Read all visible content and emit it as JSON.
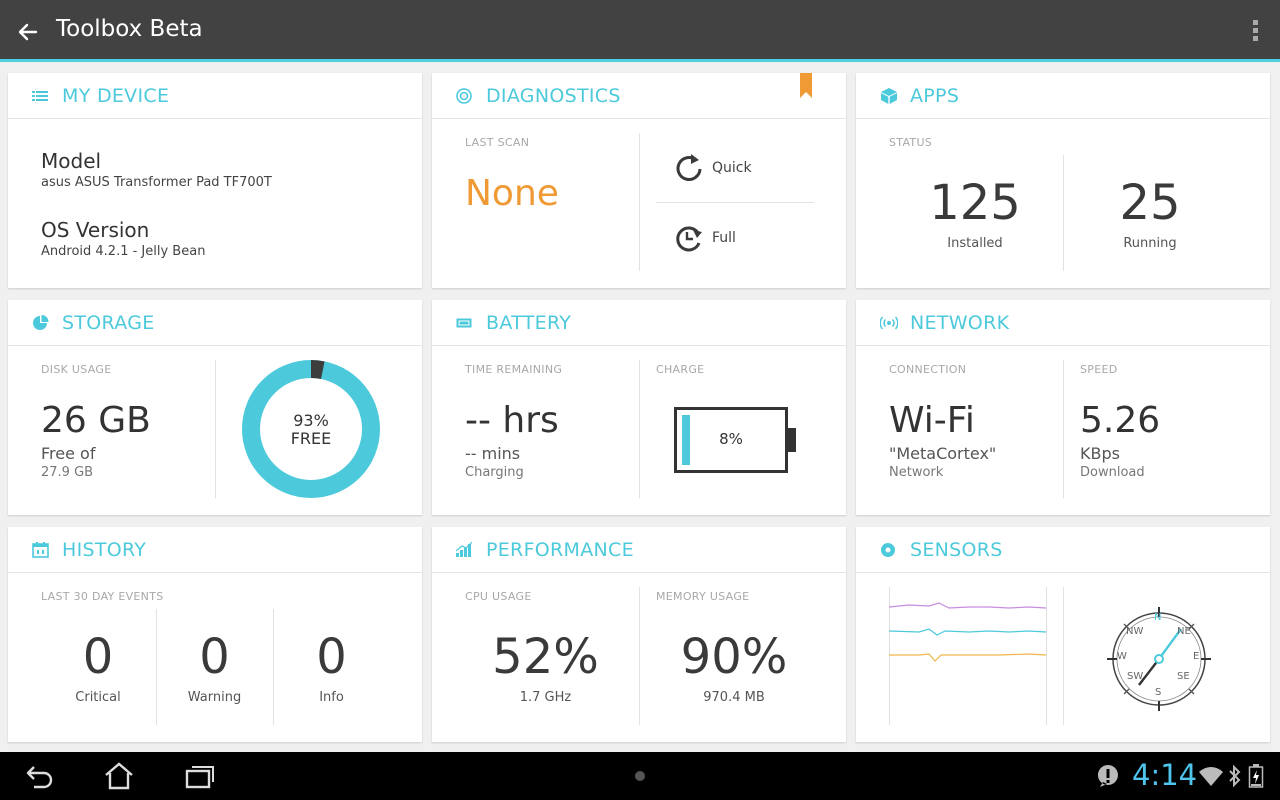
{
  "app_title": "Toolbox Beta",
  "colors": {
    "accent": "#4ccadb",
    "orange": "#f09a35",
    "actionbar": "#424242"
  },
  "cards": {
    "device": {
      "title": "MY DEVICE",
      "model_label": "Model",
      "model_value": "asus ASUS Transformer Pad TF700T",
      "os_label": "OS Version",
      "os_value": "Android 4.2.1 - Jelly Bean"
    },
    "diagnostics": {
      "title": "DIAGNOSTICS",
      "last_scan_label": "LAST SCAN",
      "last_scan_value": "None",
      "quick_label": "Quick",
      "full_label": "Full"
    },
    "apps": {
      "title": "APPS",
      "status_label": "STATUS",
      "installed_value": "125",
      "installed_label": "Installed",
      "running_value": "25",
      "running_label": "Running"
    },
    "storage": {
      "title": "STORAGE",
      "disk_usage_label": "DISK USAGE",
      "free_value": "26 GB",
      "free_of_label": "Free of",
      "total_value": "27.9 GB",
      "free_percent_text": "93%",
      "free_text": "FREE",
      "free_fraction": 0.93
    },
    "battery": {
      "title": "BATTERY",
      "time_label": "TIME REMAINING",
      "hours_value": "-- hrs",
      "mins_value": "-- mins",
      "state": "Charging",
      "charge_label": "CHARGE",
      "charge_text": "8%",
      "charge_fraction": 0.08
    },
    "network": {
      "title": "NETWORK",
      "connection_label": "CONNECTION",
      "connection_value": "Wi-Fi",
      "ssid": "\"MetaCortex\"",
      "ssid_label": "Network",
      "speed_label": "SPEED",
      "speed_value": "5.26",
      "speed_unit": "KBps",
      "speed_direction": "Download"
    },
    "history": {
      "title": "HISTORY",
      "events_label": "LAST 30 DAY EVENTS",
      "critical_value": "0",
      "critical_label": "Critical",
      "warning_value": "0",
      "warning_label": "Warning",
      "info_value": "0",
      "info_label": "Info"
    },
    "performance": {
      "title": "PERFORMANCE",
      "cpu_label": "CPU USAGE",
      "cpu_value": "52%",
      "cpu_freq": "1.7 GHz",
      "memory_label": "MEMORY USAGE",
      "memory_value": "90%",
      "memory_amount": "970.4 MB"
    },
    "sensors": {
      "title": "SENSORS",
      "compass": {
        "n": "N",
        "ne": "NE",
        "e": "E",
        "se": "SE",
        "s": "S",
        "sw": "SW",
        "w": "W",
        "nw": "NW"
      }
    }
  },
  "statusbar": {
    "time": "4:14"
  }
}
